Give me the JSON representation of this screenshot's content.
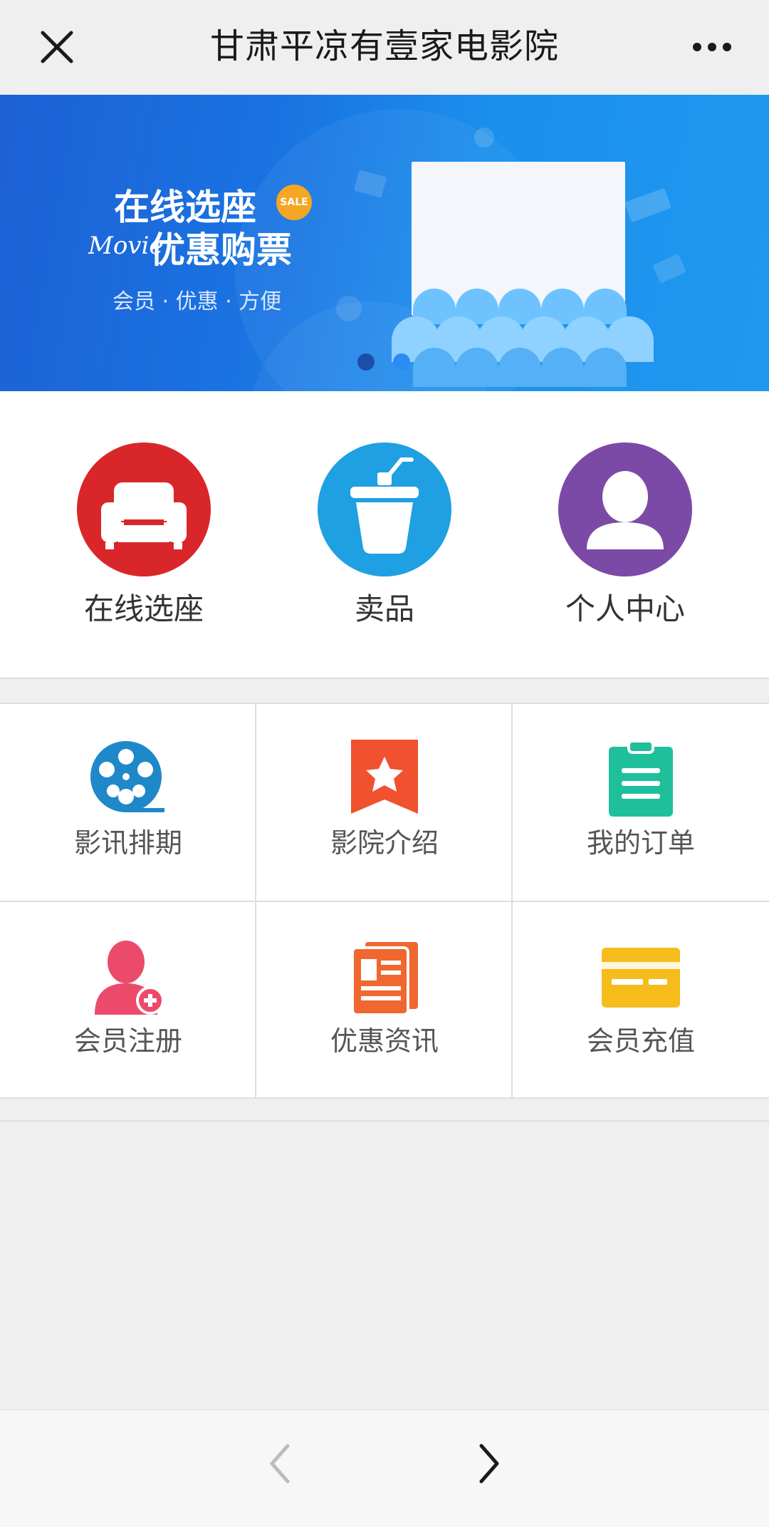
{
  "header": {
    "title": "甘肃平凉有壹家电影院",
    "close_icon": "close-icon",
    "more_icon": "more-dots-icon"
  },
  "banner": {
    "line1": "在线选座",
    "sale_badge": "SALE",
    "movie_word": "Movie",
    "line2": "优惠购票",
    "subtitle": "会员 · 优惠 · 方便",
    "slide_count": 2,
    "active_slide": 2,
    "colors": {
      "dot_inactive": "#1a4fa8",
      "dot_active": "#2a8cf4"
    }
  },
  "main_actions": [
    {
      "label": "在线选座",
      "icon": "sofa-icon",
      "color": "#d9262a"
    },
    {
      "label": "卖品",
      "icon": "drink-cup-icon",
      "color": "#1ea0e2"
    },
    {
      "label": "个人中心",
      "icon": "user-icon",
      "color": "#7b4aa6"
    }
  ],
  "grid_items": [
    {
      "label": "影讯排期",
      "icon": "film-reel-icon",
      "color": "#1e88c9"
    },
    {
      "label": "影院介绍",
      "icon": "star-bookmark-icon",
      "color": "#f0512e"
    },
    {
      "label": "我的订单",
      "icon": "clipboard-icon",
      "color": "#1fbf9c"
    },
    {
      "label": "会员注册",
      "icon": "add-user-icon",
      "color": "#ec4a6b"
    },
    {
      "label": "优惠资讯",
      "icon": "ticket-icon",
      "color": "#f0672f"
    },
    {
      "label": "会员充值",
      "icon": "card-icon",
      "color": "#f5bc1c"
    }
  ],
  "bottom_nav": {
    "back_icon": "chevron-left-icon",
    "forward_icon": "chevron-right-icon"
  }
}
